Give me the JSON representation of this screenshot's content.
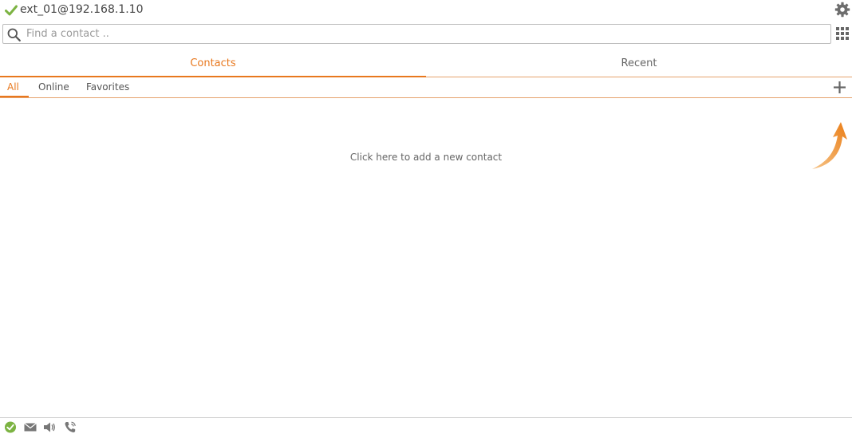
{
  "header": {
    "account": "ext_01@192.168.1.10",
    "status": "online"
  },
  "search": {
    "placeholder": "Find a contact .."
  },
  "tabs": {
    "contacts": "Contacts",
    "recent": "Recent",
    "active": "Contacts"
  },
  "filters": {
    "all": "All",
    "online": "Online",
    "favorites": "Favorites",
    "active": "All"
  },
  "empty_state": {
    "message": "Click here to add a new contact"
  },
  "footer": {
    "icons": [
      "status-check-icon",
      "mail-icon",
      "speaker-icon",
      "phone-icon"
    ]
  },
  "colors": {
    "accent": "#e8781e",
    "status_green": "#7cb342"
  }
}
